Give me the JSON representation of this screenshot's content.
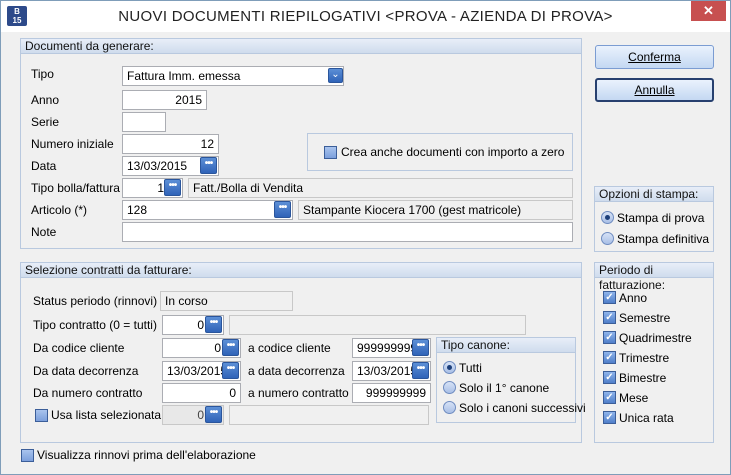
{
  "window": {
    "title": "NUOVI DOCUMENTI RIEPILOGATIVI <PROVA - AZIENDA DI PROVA>",
    "icon_text": "B\n15",
    "close_glyph": "✕"
  },
  "docs": {
    "header": "Documenti da generare:",
    "tipo": {
      "label": "Tipo",
      "value": "Fattura Imm. emessa"
    },
    "anno": {
      "label": "Anno",
      "value": "2015"
    },
    "serie": {
      "label": "Serie",
      "value": ""
    },
    "numero": {
      "label": "Numero iniziale",
      "value": "12"
    },
    "data": {
      "label": "Data",
      "value": "13/03/2015"
    },
    "tipo_bolla": {
      "label": "Tipo bolla/fattura",
      "value": "1",
      "desc": "Fatt./Bolla di Vendita"
    },
    "articolo": {
      "label": "Articolo (*)",
      "value": "128",
      "desc": "Stampante Kiocera 1700  (gest matricole)"
    },
    "note": {
      "label": "Note",
      "value": ""
    },
    "crea_zero": {
      "label": "Crea anche documenti con importo a zero",
      "checked": false
    }
  },
  "contratti": {
    "header": "Selezione contratti da fatturare:",
    "status": {
      "label": "Status periodo (rinnovi)",
      "value": "In corso"
    },
    "tipo_contratto": {
      "label": "Tipo contratto (0 = tutti)",
      "value": "0",
      "desc": ""
    },
    "da_codice": {
      "label": "Da codice cliente",
      "value": "0"
    },
    "a_codice": {
      "label": "a codice cliente",
      "value": "999999999"
    },
    "da_data": {
      "label": "Da data decorrenza",
      "value": "13/03/2015"
    },
    "a_data": {
      "label": "a data decorrenza",
      "value": "13/03/2015"
    },
    "da_numero": {
      "label": "Da numero contratto",
      "value": "0"
    },
    "a_numero": {
      "label": "a numero contratto",
      "value": "999999999"
    },
    "usa_lista": {
      "label": "Usa lista selezionata",
      "value": "0",
      "desc": "",
      "checked": false
    },
    "tipo_canone": {
      "header": "Tipo canone:",
      "options": [
        "Tutti",
        "Solo il 1° canone",
        "Solo i canoni successivi"
      ],
      "selected": "Tutti"
    }
  },
  "buttons": {
    "conferma": "Conferma",
    "annulla": "Annulla"
  },
  "stampa": {
    "header": "Opzioni di stampa:",
    "options": [
      "Stampa di prova",
      "Stampa definitiva"
    ],
    "selected": "Stampa di prova"
  },
  "periodo": {
    "header": "Periodo di fatturazione:",
    "items": [
      "Anno",
      "Semestre",
      "Quadrimestre",
      "Trimestre",
      "Bimestre",
      "Mese",
      "Unica rata"
    ],
    "checked": [
      true,
      true,
      true,
      true,
      true,
      true,
      true
    ]
  },
  "visualizza": {
    "label": "Visualizza rinnovi prima dell'elaborazione",
    "checked": false
  },
  "glyphs": {
    "ellipsis": "•••",
    "dropdown": "⌄",
    "check": "✓"
  },
  "colors": {
    "accent": "#2f63b8",
    "group_border": "#b9c9df",
    "close": "#c75050"
  }
}
